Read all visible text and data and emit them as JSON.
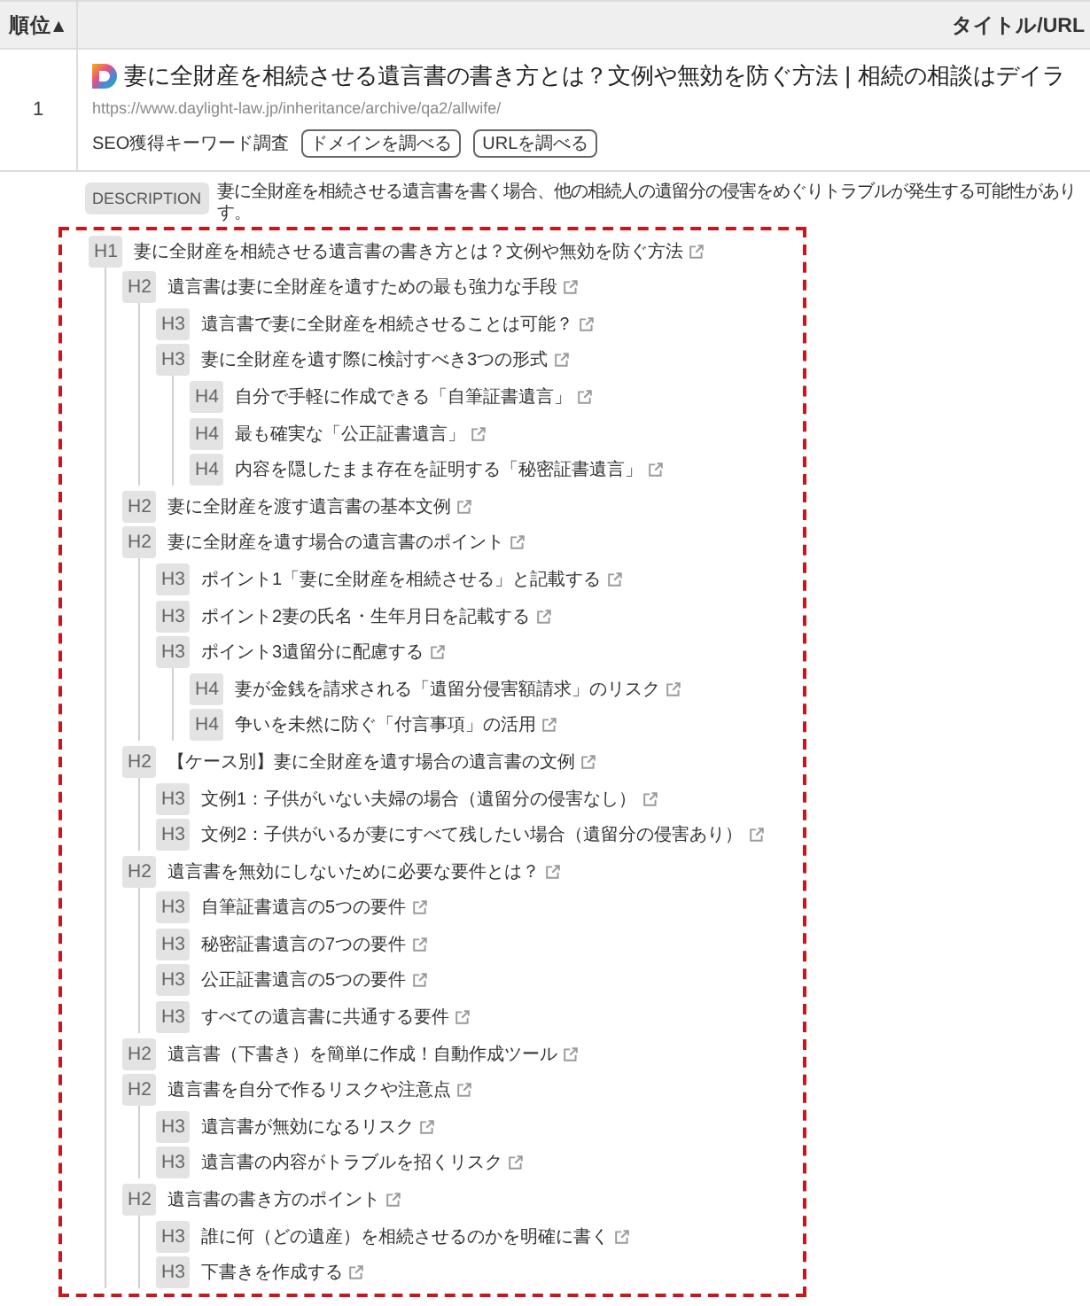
{
  "table": {
    "columns": [
      {
        "label": "順位",
        "sort_mark": "▲"
      },
      {
        "label": "タイトル/URL"
      }
    ],
    "rows": [
      {
        "rank": "1",
        "title": "妻に全財産を相続させる遺言書の書き方とは？文例や無効を防ぐ方法 | 相続の相談はデイラ",
        "url": "https://www.daylight-law.jp/inheritance/archive/qa2/allwife/",
        "tools_label": "SEO獲得キーワード調査",
        "tool_buttons": [
          "ドメインを調べる",
          "URLを調べる"
        ],
        "description": {
          "label": "DESCRIPTION",
          "lines": [
            "妻に全財産を相続させる遺言書を書く場合、他の相続人の遺留分の侵害をめぐりトラブルが発生する可能性があり",
            "す。"
          ]
        },
        "outline": {
          "highlighted": true,
          "headings": [
            {
              "tag": "H1",
              "text": "妻に全財産を相続させる遺言書の書き方とは？文例や無効を防ぐ方法",
              "children": [
                {
                  "tag": "H2",
                  "text": "遺言書は妻に全財産を遺すための最も強力な手段",
                  "children": [
                    {
                      "tag": "H3",
                      "text": "遺言書で妻に全財産を相続させることは可能？"
                    },
                    {
                      "tag": "H3",
                      "text": "妻に全財産を遺す際に検討すべき3つの形式",
                      "children": [
                        {
                          "tag": "H4",
                          "text": "自分で手軽に作成できる「自筆証書遺言」"
                        },
                        {
                          "tag": "H4",
                          "text": "最も確実な「公正証書遺言」"
                        },
                        {
                          "tag": "H4",
                          "text": "内容を隠したまま存在を証明する「秘密証書遺言」"
                        }
                      ]
                    }
                  ]
                },
                {
                  "tag": "H2",
                  "text": "妻に全財産を渡す遺言書の基本文例"
                },
                {
                  "tag": "H2",
                  "text": "妻に全財産を遺す場合の遺言書のポイント",
                  "children": [
                    {
                      "tag": "H3",
                      "text": "ポイント1「妻に全財産を相続させる」と記載する"
                    },
                    {
                      "tag": "H3",
                      "text": "ポイント2妻の氏名・生年月日を記載する"
                    },
                    {
                      "tag": "H3",
                      "text": "ポイント3遺留分に配慮する",
                      "children": [
                        {
                          "tag": "H4",
                          "text": "妻が金銭を請求される「遺留分侵害額請求」のリスク"
                        },
                        {
                          "tag": "H4",
                          "text": "争いを未然に防ぐ「付言事項」の活用"
                        }
                      ]
                    }
                  ]
                },
                {
                  "tag": "H2",
                  "text": "【ケース別】妻に全財産を遺す場合の遺言書の文例",
                  "children": [
                    {
                      "tag": "H3",
                      "text": "文例1：子供がいない夫婦の場合（遺留分の侵害なし）"
                    },
                    {
                      "tag": "H3",
                      "text": "文例2：子供がいるが妻にすべて残したい場合（遺留分の侵害あり）"
                    }
                  ]
                },
                {
                  "tag": "H2",
                  "text": "遺言書を無効にしないために必要な要件とは？",
                  "children": [
                    {
                      "tag": "H3",
                      "text": "自筆証書遺言の5つの要件"
                    },
                    {
                      "tag": "H3",
                      "text": "秘密証書遺言の7つの要件"
                    },
                    {
                      "tag": "H3",
                      "text": "公正証書遺言の5つの要件"
                    },
                    {
                      "tag": "H3",
                      "text": "すべての遺言書に共通する要件"
                    }
                  ]
                },
                {
                  "tag": "H2",
                  "text": "遺言書（下書き）を簡単に作成！自動作成ツール"
                },
                {
                  "tag": "H2",
                  "text": "遺言書を自分で作るリスクや注意点",
                  "children": [
                    {
                      "tag": "H3",
                      "text": "遺言書が無効になるリスク"
                    },
                    {
                      "tag": "H3",
                      "text": "遺言書の内容がトラブルを招くリスク"
                    }
                  ]
                },
                {
                  "tag": "H2",
                  "text": "遺言書の書き方のポイント",
                  "children": [
                    {
                      "tag": "H3",
                      "text": "誰に何（どの遺産）を相続させるのかを明確に書く"
                    },
                    {
                      "tag": "H3",
                      "text": "下書きを作成する"
                    }
                  ]
                }
              ]
            }
          ]
        }
      }
    ]
  }
}
